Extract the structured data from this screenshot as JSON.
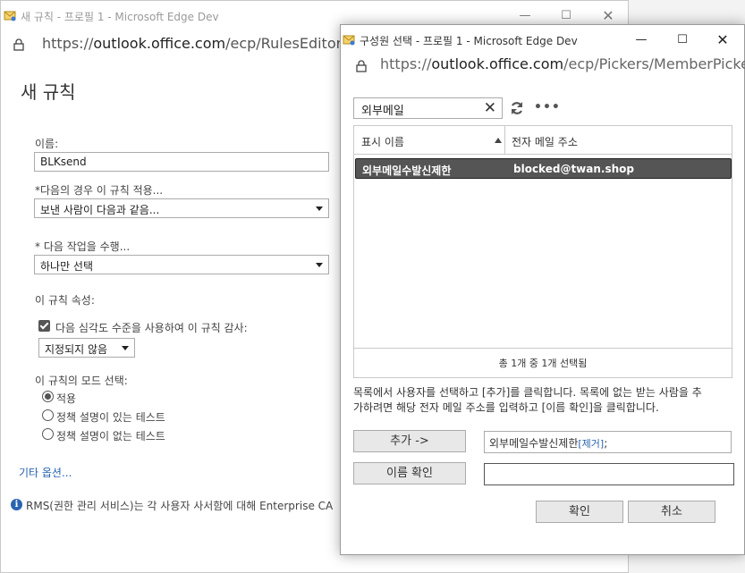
{
  "back_window": {
    "title": "새 규칙 - 프로필 1 - Microsoft Edge Dev",
    "url_prefix": "https://",
    "url_host": "outlook.office.com",
    "url_path": "/ecp/RulesEditor/New",
    "page_title": "새 규칙",
    "name_label": "이름:",
    "name_value": "BLKsend",
    "condition_label": "*다음의 경우 이 규칙 적용...",
    "condition_value": "보낸 사람이 다음과 같음...",
    "action_label": "* 다음 작업을 수행...",
    "action_value": "하나만 선택",
    "properties_label": "이 규칙 속성:",
    "audit_checkbox_label": "다음 심각도 수준을 사용하여 이 규칙 감사:",
    "audit_checked": true,
    "severity_value": "지정되지 않음",
    "mode_label": "이 규칙의 모드 선택:",
    "modes": [
      {
        "label": "적용",
        "selected": true
      },
      {
        "label": "정책 설명이 있는 테스트",
        "selected": false
      },
      {
        "label": "정책 설명이 없는 테스트",
        "selected": false
      }
    ],
    "more_options": "기타 옵션...",
    "rms_text": "RMS(권한 관리 서비스)는 각 사용자 사서함에 대해 Enterprise CA"
  },
  "front_window": {
    "title": "구성원 선택 - 프로필 1 - Microsoft Edge Dev",
    "url_prefix": "https://",
    "url_host": "outlook.office.com",
    "url_path": "/ecp/Pickers/MemberPicke...",
    "search_value": "외부메일",
    "columns": [
      "표시 이름",
      "전자 메일 주소"
    ],
    "rows": [
      {
        "display_name": "외부메일수발신제한",
        "email": "blocked@twan.shop",
        "selected": true
      }
    ],
    "footer": "총 1개 중 1개 선택됨",
    "help_line1": "목록에서 사용자를 선택하고 [추가]를 클릭합니다. 목록에 없는 받는 사람을 추",
    "help_line2": "가하려면 해당 전자 메일 주소를 입력하고 [이름 확인]을 클릭합니다.",
    "add_button": "추가 ->",
    "added_name": "외부메일수발신제한",
    "remove_link": "[제거]",
    "added_suffix": ";",
    "check_names_button": "이름 확인",
    "ok_button": "확인",
    "cancel_button": "취소"
  }
}
